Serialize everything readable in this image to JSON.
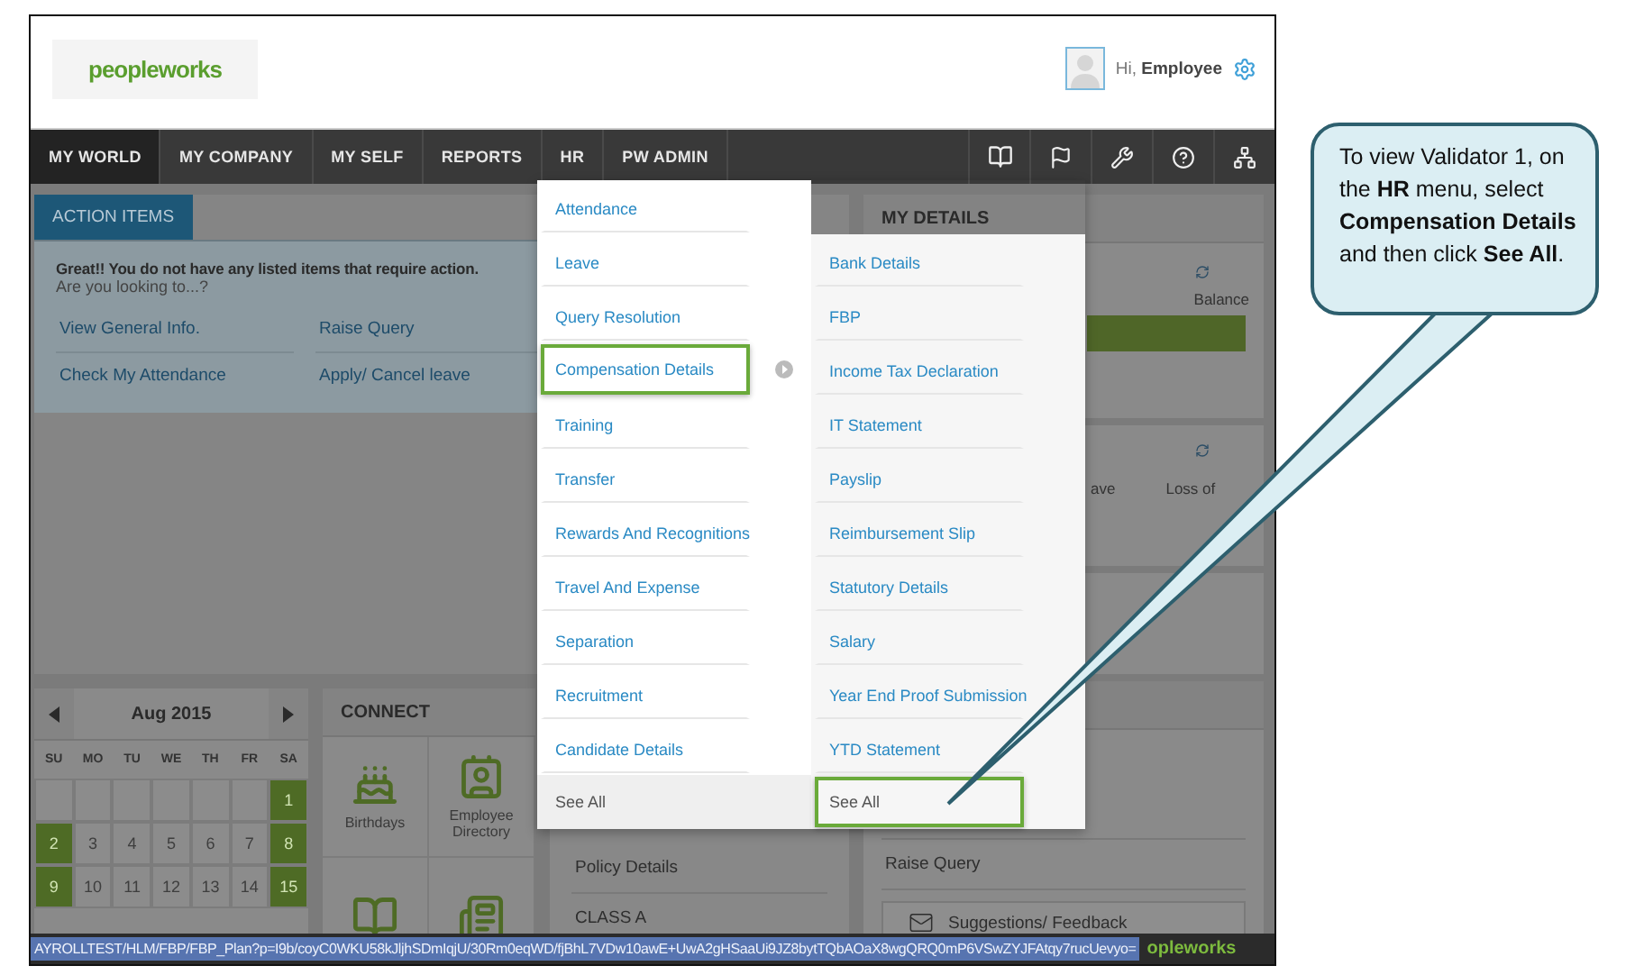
{
  "header": {
    "logo": "peopleworks",
    "greeting": "Hi,",
    "user": "Employee"
  },
  "nav": {
    "tabs": [
      {
        "label": "MY WORLD",
        "selected": true
      },
      {
        "label": "MY COMPANY",
        "selected": false
      },
      {
        "label": "MY SELF",
        "selected": false
      },
      {
        "label": "REPORTS",
        "selected": false
      },
      {
        "label": "HR",
        "selected": false
      },
      {
        "label": "PW ADMIN",
        "selected": false
      }
    ]
  },
  "hr_menu": {
    "items": [
      {
        "label": "Attendance",
        "highlighted": false,
        "has_submenu": false
      },
      {
        "label": "Leave",
        "highlighted": false,
        "has_submenu": false
      },
      {
        "label": "Query Resolution",
        "highlighted": false,
        "has_submenu": false
      },
      {
        "label": "Compensation Details",
        "highlighted": true,
        "has_submenu": true
      },
      {
        "label": "Training",
        "highlighted": false,
        "has_submenu": false
      },
      {
        "label": "Transfer",
        "highlighted": false,
        "has_submenu": false
      },
      {
        "label": "Rewards And Recognitions",
        "highlighted": false,
        "has_submenu": false
      },
      {
        "label": "Travel And Expense",
        "highlighted": false,
        "has_submenu": false
      },
      {
        "label": "Separation",
        "highlighted": false,
        "has_submenu": false
      },
      {
        "label": "Recruitment",
        "highlighted": false,
        "has_submenu": false
      },
      {
        "label": "Candidate Details",
        "highlighted": false,
        "has_submenu": false
      }
    ],
    "see_all": {
      "label": "See All",
      "highlighted": false
    },
    "submenu": {
      "items": [
        {
          "label": "Bank Details",
          "highlighted": false
        },
        {
          "label": "FBP",
          "highlighted": false
        },
        {
          "label": "Income Tax Declaration",
          "highlighted": false
        },
        {
          "label": "IT Statement",
          "highlighted": false
        },
        {
          "label": "Payslip",
          "highlighted": false
        },
        {
          "label": "Reimbursement Slip",
          "highlighted": false
        },
        {
          "label": "Statutory Details",
          "highlighted": false
        },
        {
          "label": "Salary",
          "highlighted": false
        },
        {
          "label": "Year End Proof Submission",
          "highlighted": false
        },
        {
          "label": "YTD Statement",
          "highlighted": false
        }
      ],
      "see_all": {
        "label": "See All",
        "highlighted": true
      }
    }
  },
  "action_items": {
    "tab": "ACTION ITEMS",
    "message": "Great!! You do not have any listed items that require action.",
    "prompt": "Are you looking to...?",
    "links": [
      "View General Info.",
      "Raise Query",
      "Check My Attendance",
      "Apply/ Cancel leave"
    ]
  },
  "my_details": {
    "title": "MY DETAILS",
    "balance_label": "Balance"
  },
  "leave_summary": {
    "column_1": "ave",
    "column_2": "Loss of"
  },
  "calendar": {
    "month": "Aug 2015",
    "weekdays": [
      "SU",
      "MO",
      "TU",
      "WE",
      "TH",
      "FR",
      "SA"
    ],
    "weeks": [
      [
        {
          "kind": "blank",
          "weekend": false
        },
        {
          "kind": "blank",
          "weekend": false
        },
        {
          "kind": "blank",
          "weekend": false
        },
        {
          "kind": "blank",
          "weekend": false
        },
        {
          "kind": "blank",
          "weekend": false
        },
        {
          "kind": "blank",
          "weekend": false
        },
        {
          "kind": "day",
          "day": "1",
          "weekend": true
        }
      ],
      [
        {
          "kind": "day",
          "day": "2",
          "weekend": true
        },
        {
          "kind": "day",
          "day": "3",
          "weekend": false
        },
        {
          "kind": "day",
          "day": "4",
          "weekend": false
        },
        {
          "kind": "day",
          "day": "5",
          "weekend": false
        },
        {
          "kind": "day",
          "day": "6",
          "weekend": false
        },
        {
          "kind": "day",
          "day": "7",
          "weekend": false
        },
        {
          "kind": "day",
          "day": "8",
          "weekend": true
        }
      ],
      [
        {
          "kind": "day",
          "day": "9",
          "weekend": true
        },
        {
          "kind": "day",
          "day": "10",
          "weekend": false
        },
        {
          "kind": "day",
          "day": "11",
          "weekend": false
        },
        {
          "kind": "day",
          "day": "12",
          "weekend": false
        },
        {
          "kind": "day",
          "day": "13",
          "weekend": false
        },
        {
          "kind": "day",
          "day": "14",
          "weekend": false
        },
        {
          "kind": "day",
          "day": "15",
          "weekend": true
        }
      ]
    ]
  },
  "connect": {
    "title": "CONNECT",
    "tiles": [
      {
        "kind": "cake",
        "label": "Birthdays"
      },
      {
        "kind": "contact",
        "label": "Employee Directory"
      },
      {
        "kind": "book"
      },
      {
        "kind": "news"
      }
    ]
  },
  "policy": {
    "rows": [
      "Policy Details",
      "CLASS A"
    ]
  },
  "requests": {
    "links": [
      "Raise Query"
    ],
    "feedback_button": "Suggestions/ Feedback"
  },
  "status_bar": {
    "url": "AYROLLTEST/HLM/FBP/FBP_Plan?p=I9b/coyC0WKU58kJljhSDmIqjU/30Rm0eqWD/fjBhL7VDw10awE+UwA2gHSaaUi9JZ8bytTQbAOaX8wgQRQ0mP6VSwZYJFAtqy7rucUevyo=",
    "logo": "opleworks"
  },
  "callout": {
    "text": "To view Validator 1, on the **HR** menu, select **Compensation Details** and then click **See All**."
  }
}
